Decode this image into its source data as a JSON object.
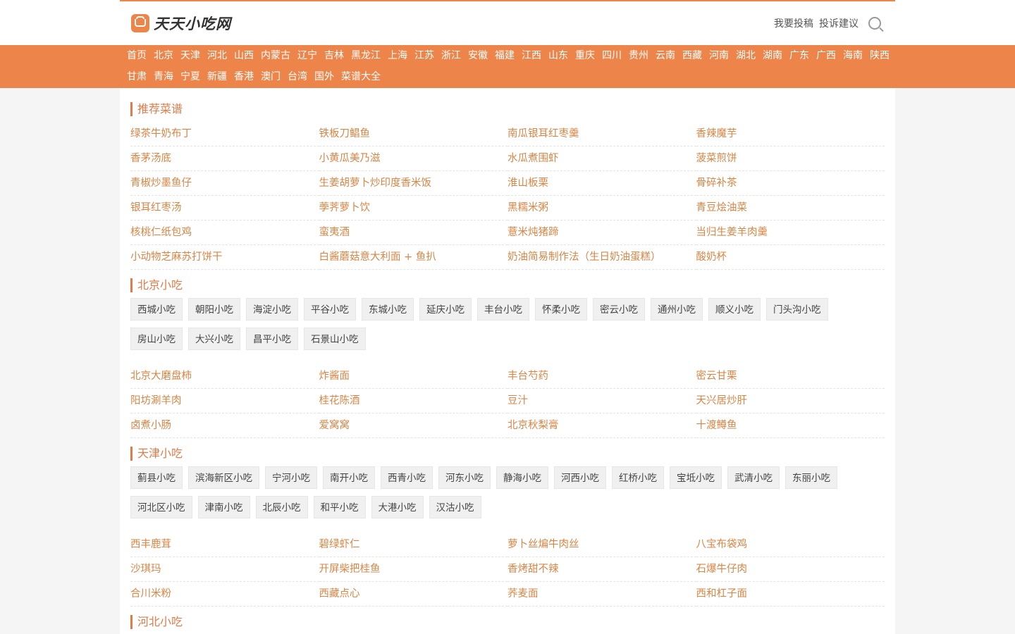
{
  "site": {
    "logo_text": "天天小吃网"
  },
  "header": {
    "links": [
      "我要投稿",
      "投诉建议"
    ]
  },
  "nav": [
    "首页",
    "北京",
    "天津",
    "河北",
    "山西",
    "内蒙古",
    "辽宁",
    "吉林",
    "黑龙江",
    "上海",
    "江苏",
    "浙江",
    "安徽",
    "福建",
    "江西",
    "山东",
    "重庆",
    "四川",
    "贵州",
    "云南",
    "西藏",
    "河南",
    "湖北",
    "湖南",
    "广东",
    "广西",
    "海南",
    "陕西",
    "甘肃",
    "青海",
    "宁夏",
    "新疆",
    "香港",
    "澳门",
    "台湾",
    "国外",
    "菜谱大全"
  ],
  "recommended": {
    "title": "推荐菜谱",
    "items": [
      "绿茶牛奶布丁",
      "铁板刀鲳鱼",
      "南瓜银耳红枣羹",
      "香辣魔芋",
      "香茅汤底",
      "小黄瓜美乃滋",
      "水瓜煮围虾",
      "菠菜煎饼",
      "青椒炒墨鱼仔",
      "生姜胡萝卜炒印度香米饭",
      "淮山板栗",
      "骨碎补茶",
      "银耳红枣汤",
      "荸荠萝卜饮",
      "黑糯米粥",
      "青豆烩油菜",
      "核桃仁纸包鸡",
      "蛮夷酒",
      "薏米炖猪蹄",
      "当归生姜羊肉羹",
      "小动物芝麻苏打饼干",
      "白酱蘑菇意大利面 + 鱼扒",
      "奶油简易制作法（生日奶油蛋糕）",
      "酸奶杯"
    ]
  },
  "beijing": {
    "title": "北京小吃",
    "tags": [
      "西城小吃",
      "朝阳小吃",
      "海淀小吃",
      "平谷小吃",
      "东城小吃",
      "延庆小吃",
      "丰台小吃",
      "怀柔小吃",
      "密云小吃",
      "通州小吃",
      "顺义小吃",
      "门头沟小吃",
      "房山小吃",
      "大兴小吃",
      "昌平小吃",
      "石景山小吃"
    ],
    "items": [
      "北京大磨盘柿",
      "炸酱面",
      "丰台芍药",
      "密云甘栗",
      "阳坊涮羊肉",
      "桂花陈酒",
      "豆汁",
      "天兴居炒肝",
      "卤煮小肠",
      "爱窝窝",
      "北京秋梨膏",
      "十渡鳟鱼"
    ]
  },
  "tianjin": {
    "title": "天津小吃",
    "tags": [
      "蓟县小吃",
      "滨海新区小吃",
      "宁河小吃",
      "南开小吃",
      "西青小吃",
      "河东小吃",
      "静海小吃",
      "河西小吃",
      "红桥小吃",
      "宝坻小吃",
      "武清小吃",
      "东丽小吃",
      "河北区小吃",
      "津南小吃",
      "北辰小吃",
      "和平小吃",
      "大港小吃",
      "汉沽小吃"
    ],
    "items": [
      "西丰鹿茸",
      "碧绿虾仁",
      "萝卜丝煸牛肉丝",
      "八宝布袋鸡",
      "沙琪玛",
      "开屏柴把桂鱼",
      "香烤甜不辣",
      "石爆牛仔肉",
      "合川米粉",
      "西藏点心",
      "荞麦面",
      "西和杠子面"
    ]
  },
  "hebei": {
    "title": "河北小吃"
  }
}
